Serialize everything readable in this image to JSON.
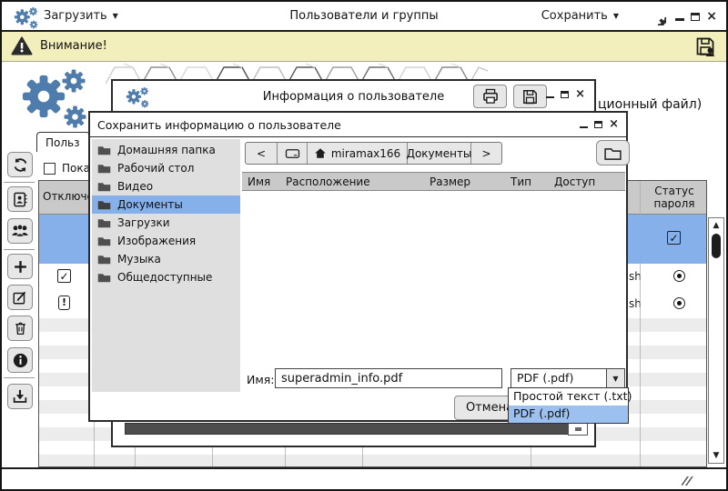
{
  "titlebar": {
    "load_label": "Загрузить",
    "title": "Пользователи и группы",
    "save_label": "Сохранить"
  },
  "warning": {
    "text": "Внимание!"
  },
  "background": {
    "clipped_config_text": "ционный файл)",
    "tab_label": "Польз",
    "show_checkbox_label": "Показ",
    "table": {
      "col_disabled": "Отключен",
      "col_password_status": "Статус пароля",
      "shell_value": "sh"
    }
  },
  "info_dialog": {
    "title": "Информация о пользователе"
  },
  "save_dialog": {
    "title": "Сохранить информацию о пользователе",
    "places": [
      "Домашняя папка",
      "Рабочий стол",
      "Видео",
      "Документы",
      "Загрузки",
      "Изображения",
      "Музыка",
      "Общедоступные"
    ],
    "selected_place": "Документы",
    "nav": {
      "back": "<",
      "forward": ">",
      "home_label": "miramax166",
      "path_label": "Документы"
    },
    "columns": [
      "Имя",
      "Расположение",
      "Размер",
      "Тип",
      "Доступ"
    ],
    "name_label": "Имя:",
    "filename": "superadmin_info.pdf",
    "filetype": {
      "selected": "PDF (.pdf)",
      "options": [
        "Простой текст (.txt)",
        "PDF (.pdf)"
      ],
      "highlighted_option": "PDF (.pdf)"
    },
    "cancel_label": "Отмена"
  },
  "glyphs": {
    "check": "✓",
    "close": "×",
    "dropdown_arrow": "▼",
    "menu_arrow": "▼",
    "scroll_up": "▲",
    "scroll_down": "▼",
    "exclamation": "!"
  },
  "colors": {
    "selection_blue": "#85b0e9",
    "popup_highlight": "#9cc0f0",
    "warning_bg": "#f2efbc",
    "accent_blue": "#4e7cad"
  }
}
